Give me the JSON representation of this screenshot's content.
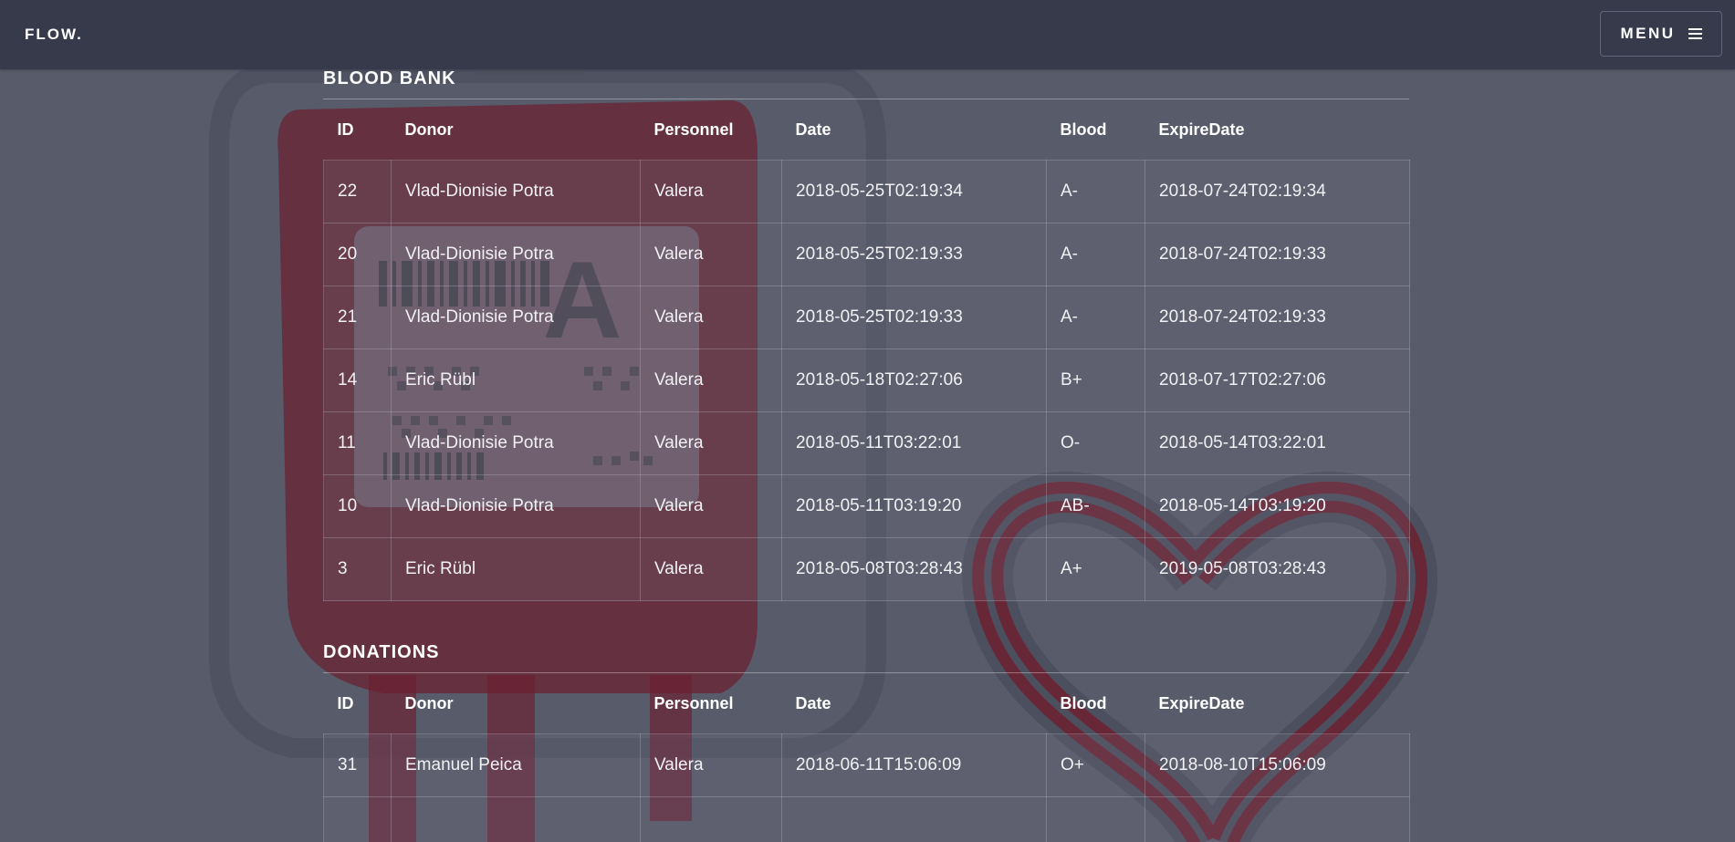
{
  "navbar": {
    "brand": "FLOW.",
    "menu_label": "MENU",
    "menu_icon": "hamburger-icon"
  },
  "blood_bank": {
    "title": "BLOOD BANK",
    "columns": [
      "ID",
      "Donor",
      "Personnel",
      "Date",
      "Blood",
      "ExpireDate"
    ],
    "rows": [
      [
        "22",
        "Vlad-Dionisie Potra",
        "Valera",
        "2018-05-25T02:19:34",
        "A-",
        "2018-07-24T02:19:34"
      ],
      [
        "20",
        "Vlad-Dionisie Potra",
        "Valera",
        "2018-05-25T02:19:33",
        "A-",
        "2018-07-24T02:19:33"
      ],
      [
        "21",
        "Vlad-Dionisie Potra",
        "Valera",
        "2018-05-25T02:19:33",
        "A-",
        "2018-07-24T02:19:33"
      ],
      [
        "14",
        "Eric Rübl",
        "Valera",
        "2018-05-18T02:27:06",
        "B+",
        "2018-07-17T02:27:06"
      ],
      [
        "11",
        "Vlad-Dionisie Potra",
        "Valera",
        "2018-05-11T03:22:01",
        "O-",
        "2018-05-14T03:22:01"
      ],
      [
        "10",
        "Vlad-Dionisie Potra",
        "Valera",
        "2018-05-11T03:19:20",
        "AB-",
        "2018-05-14T03:19:20"
      ],
      [
        "3",
        "Eric Rübl",
        "Valera",
        "2018-05-08T03:28:43",
        "A+",
        "2019-05-08T03:28:43"
      ]
    ]
  },
  "donations": {
    "title": "DONATIONS",
    "columns": [
      "ID",
      "Donor",
      "Personnel",
      "Date",
      "Blood",
      "ExpireDate"
    ],
    "rows": [
      [
        "31",
        "Emanuel Peica",
        "Valera",
        "2018-06-11T15:06:09",
        "O+",
        "2018-08-10T15:06:09"
      ],
      [
        "",
        "",
        "",
        "",
        "",
        ""
      ]
    ]
  },
  "background": {
    "blood_bag_label_letter": "A",
    "colors": {
      "page": "#585b6a",
      "navbar": "#373a4b",
      "blood": "#6b1f2f"
    }
  }
}
